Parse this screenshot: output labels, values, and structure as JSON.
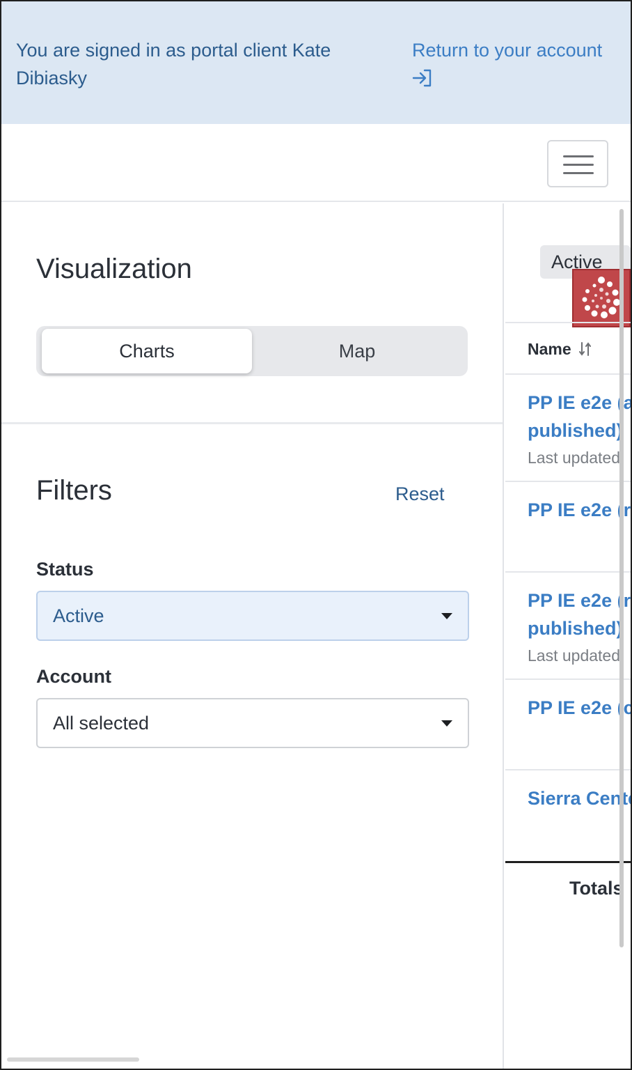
{
  "banner": {
    "message": "You are signed in as portal client Kate Dibiasky",
    "return_link": "Return to your account",
    "return_icon": "sign-in-arrow-icon"
  },
  "navbar": {
    "menu_icon": "hamburger-menu-icon"
  },
  "visualization": {
    "title": "Visualization",
    "tabs": [
      {
        "label": "Charts",
        "selected": true
      },
      {
        "label": "Map",
        "selected": false
      }
    ]
  },
  "filters": {
    "title": "Filters",
    "reset_label": "Reset",
    "status": {
      "label": "Status",
      "value": "Active"
    },
    "account": {
      "label": "Account",
      "value": "All selected"
    }
  },
  "results": {
    "active_chip": "Active",
    "loading_icon": "loading-spinner-icon",
    "name_header": "Name",
    "sort_icon": "sort-icon",
    "rows": [
      {
        "title_line1": "PP IE e2e (a",
        "title_line2": "published)",
        "subtitle": "Last updated"
      },
      {
        "title_line1": "PP IE e2e (r",
        "title_line2": "",
        "subtitle": ""
      },
      {
        "title_line1": "PP IE e2e (r",
        "title_line2": "published)",
        "subtitle": "Last updated"
      },
      {
        "title_line1": "PP IE e2e (c",
        "title_line2": "",
        "subtitle": ""
      },
      {
        "title_line1": "Sierra Cente",
        "title_line2": "",
        "subtitle": ""
      }
    ],
    "totals_label": "Totals"
  },
  "colors": {
    "banner_bg": "#dce7f3",
    "link_blue": "#3b7dc4",
    "dark_blue_text": "#2c5c8d",
    "spinner_red": "#c0474a"
  }
}
